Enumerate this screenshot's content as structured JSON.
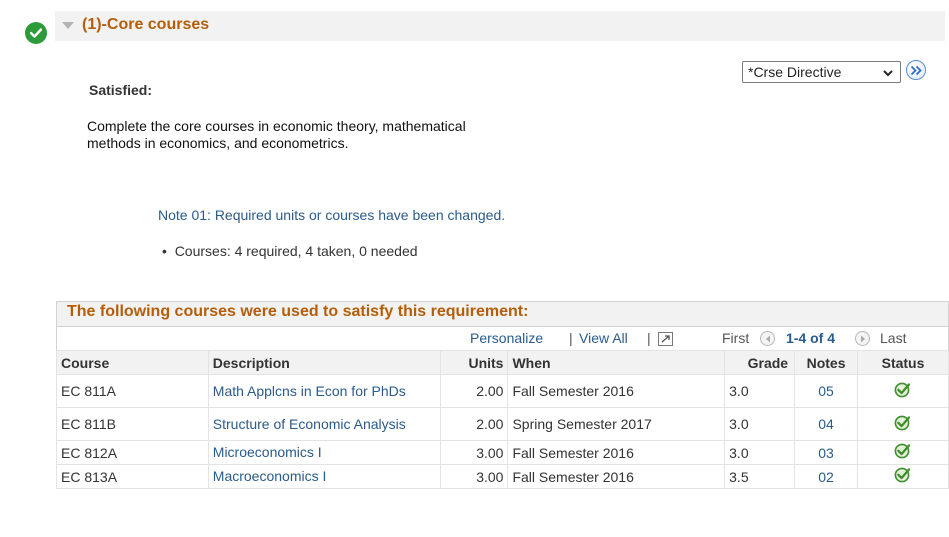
{
  "requirement": {
    "title": "(1)-Core courses",
    "status_label": "Satisfied:",
    "description": "Complete the core courses in economic theory, mathematical methods in economics, and econometrics.",
    "note": "Note 01: Required units or courses have been changed.",
    "courses_summary": "Courses: 4 required, 4 taken, 0 needed",
    "status_icon": "check-circle-icon",
    "status_color": "#2e9b3a",
    "title_color": "#b55e0a"
  },
  "directive": {
    "selected": "*Crse Directive"
  },
  "grid": {
    "title": "The following courses were used to satisfy this requirement:",
    "nav": {
      "personalize": "Personalize",
      "view_all": "View All",
      "sep1": "|",
      "sep2": "|",
      "first": "First",
      "range": "1-4 of 4",
      "last": "Last"
    },
    "columns": {
      "course": "Course",
      "description": "Description",
      "units": "Units",
      "when": "When",
      "grade": "Grade",
      "notes": "Notes",
      "status": "Status"
    },
    "rows": [
      {
        "course": "EC 811A",
        "description": "Math Applcns in Econ for PhDs",
        "units": "2.00",
        "when": "Fall Semester 2016",
        "grade": "3.0",
        "notes": "05",
        "status": "check-icon"
      },
      {
        "course": "EC 811B",
        "description": "Structure of Economic Analysis",
        "units": "2.00",
        "when": "Spring Semester 2017",
        "grade": "3.0",
        "notes": "04",
        "status": "check-icon"
      },
      {
        "course": "EC 812A",
        "description": "Microeconomics I",
        "units": "3.00",
        "when": "Fall Semester 2016",
        "grade": "3.0",
        "notes": "03",
        "status": "check-icon"
      },
      {
        "course": "EC 813A",
        "description": "Macroeconomics I",
        "units": "3.00",
        "when": "Fall Semester 2016",
        "grade": "3.5",
        "notes": "02",
        "status": "check-icon"
      }
    ]
  }
}
